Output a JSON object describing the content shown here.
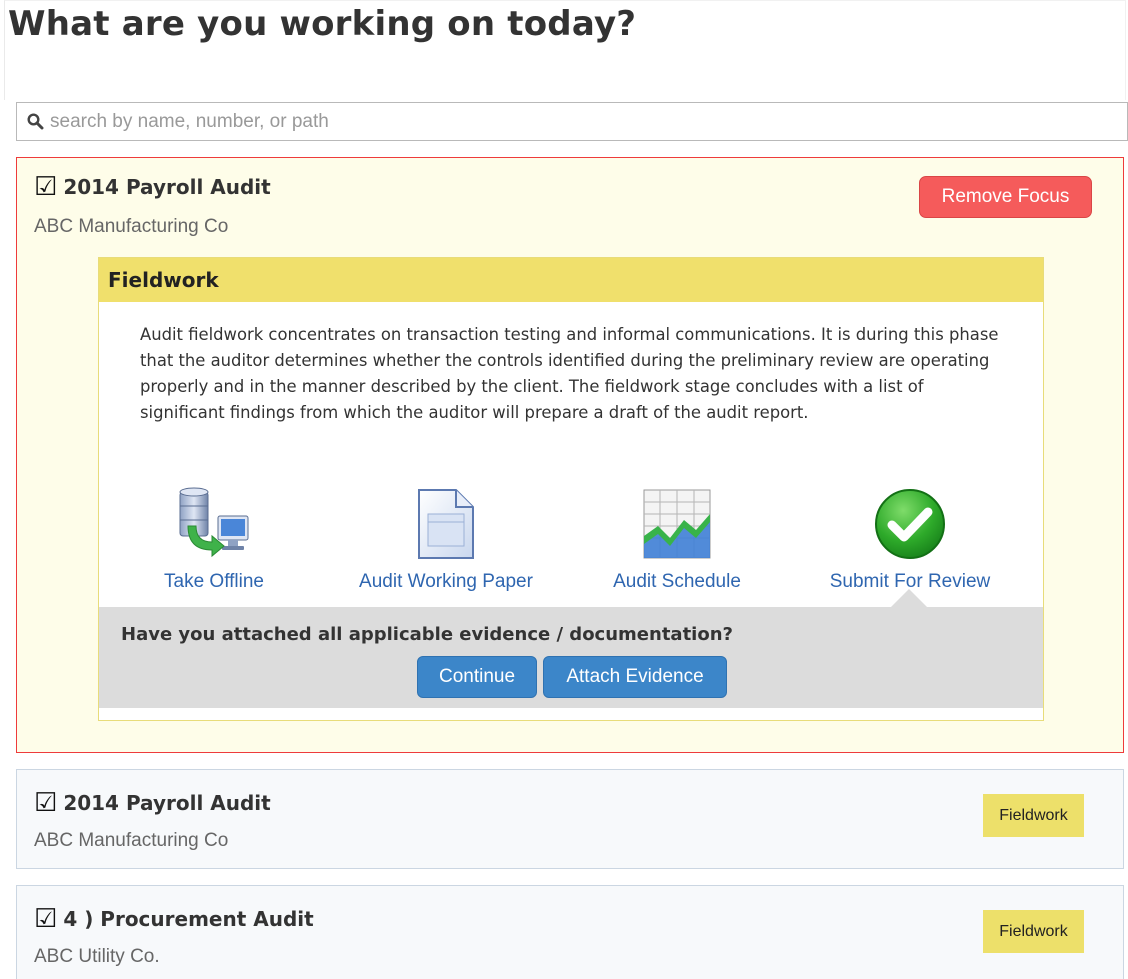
{
  "page": {
    "title": "What are you working on today?"
  },
  "search": {
    "placeholder": "search by name, number, or path",
    "icon": "search-icon"
  },
  "focus_card": {
    "title": "2014 Payroll Audit",
    "client": "ABC Manufacturing Co",
    "remove_label": "Remove Focus",
    "border_color": "#ee3b3b",
    "phase": {
      "name": "Fieldwork",
      "description": "Audit fieldwork concentrates on transaction testing and informal communications. It is during this phase that the auditor determines whether the controls identified during the preliminary review are operating properly and in the manner described by the client. The fieldwork stage concludes with a list of significant findings from which the auditor will prepare a draft of the audit report.",
      "actions": [
        {
          "label": "Take Offline",
          "icon": "database-to-computer-icon"
        },
        {
          "label": "Audit Working Paper",
          "icon": "document-icon"
        },
        {
          "label": "Audit Schedule",
          "icon": "spreadsheet-chart-icon"
        },
        {
          "label": "Submit For Review",
          "icon": "green-check-icon"
        }
      ],
      "confirm": {
        "question": "Have you attached all applicable evidence / documentation?",
        "continue_label": "Continue",
        "attach_label": "Attach Evidence"
      }
    }
  },
  "engagements": [
    {
      "title": "2014 Payroll Audit",
      "client": "ABC Manufacturing Co",
      "phase": "Fieldwork"
    },
    {
      "title": "4 ) Procurement Audit",
      "client": "ABC Utility Co.",
      "phase": "Fieldwork"
    }
  ],
  "colors": {
    "accent_blue": "#3c86c9",
    "danger_red": "#f55b5b",
    "phase_yellow": "#f0e06c",
    "link_blue": "#2f66b0"
  }
}
